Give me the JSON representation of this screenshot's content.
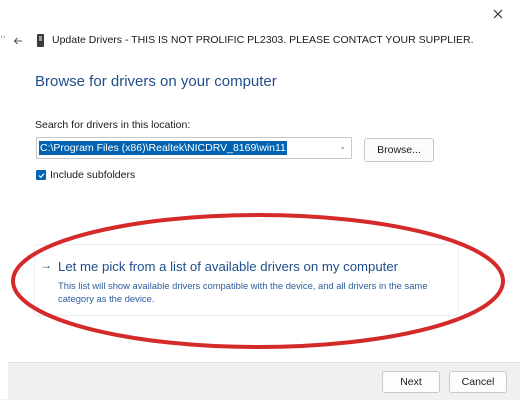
{
  "window": {
    "title": "Update Drivers - THIS IS NOT PROLIFIC PL2303. PLEASE CONTACT YOUR SUPPLIER."
  },
  "heading": "Browse for drivers on your computer",
  "search": {
    "label": "Search for drivers in this location:",
    "value": "C:\\Program Files (x86)\\Realtek\\NICDRV_8169\\win11",
    "browse_label": "Browse..."
  },
  "include_subfolders": {
    "label": "Include subfolders",
    "checked": true
  },
  "pick_option": {
    "arrow": "→",
    "title": "Let me pick from a list of available drivers on my computer",
    "description": "This list will show available drivers compatible with the device, and all drivers in the same category as the device."
  },
  "footer": {
    "next_label": "Next",
    "cancel_label": "Cancel"
  },
  "icons": {
    "close": "close-icon",
    "back": "back-arrow-icon",
    "device": "usb-device-icon",
    "checkmark": "checkmark-icon",
    "dropdown": "chevron-down-icon"
  },
  "colors": {
    "accent": "#0063b1",
    "link": "#1f4e8c",
    "annotation": "#d42a2a"
  }
}
